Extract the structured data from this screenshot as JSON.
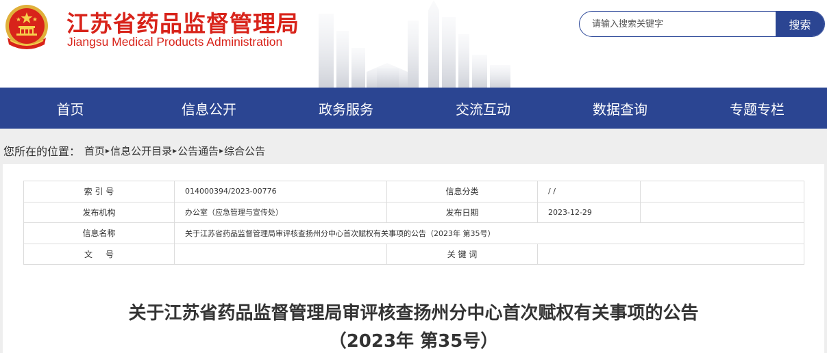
{
  "header": {
    "title": "江苏省药品监督管理局",
    "subtitle": "Jiangsu Medical Products Administration",
    "emblem_icon": "national-emblem-icon",
    "search": {
      "placeholder": "请输入搜索关键字",
      "button_label": "搜索"
    }
  },
  "nav": {
    "items": [
      {
        "label": "首页"
      },
      {
        "label": "信息公开"
      },
      {
        "label": "政务服务"
      },
      {
        "label": "交流互动"
      },
      {
        "label": "数据查询"
      },
      {
        "label": "专题专栏"
      }
    ]
  },
  "breadcrumb": {
    "label": "您所在的位置：",
    "separator": "▸",
    "items": [
      {
        "label": "首页"
      },
      {
        "label": "信息公开目录"
      },
      {
        "label": "公告通告"
      },
      {
        "label": "综合公告"
      }
    ]
  },
  "info": {
    "index_label": "索 引 号",
    "index_value": "014000394/2023-00776",
    "category_label": "信息分类",
    "category_value": "/     /",
    "org_label": "发布机构",
    "org_value": "办公室（应急管理与宣传处）",
    "date_label": "发布日期",
    "date_value": "2023-12-29",
    "name_label": "信息名称",
    "name_value": "关于江苏省药品监督管理局审评核查扬州分中心首次赋权有关事项的公告（2023年 第35号）",
    "docno_label": "文     号",
    "docno_value": "",
    "keyword_label": "关 键 词",
    "keyword_value": ""
  },
  "document": {
    "title_line1": "关于江苏省药品监督管理局审评核查扬州分中心首次赋权有关事项的公告",
    "title_line2": "（2023年 第35号）"
  },
  "colors": {
    "brand_red": "#d8231a",
    "nav_blue": "#2b4592",
    "background_gray": "#eeeeee"
  }
}
